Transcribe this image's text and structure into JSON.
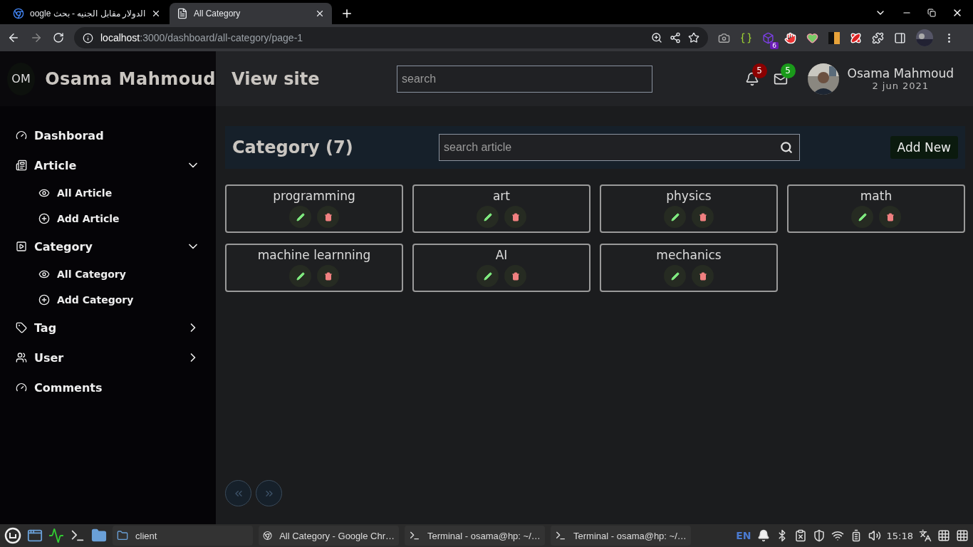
{
  "browser": {
    "tabs": [
      {
        "title": "الدولار مقابل الجنيه - بحث oogle",
        "selected": false
      },
      {
        "title": "All Category",
        "selected": true
      }
    ],
    "url_host": "localhost",
    "url_path": ":3000/dashboard/all-category/page-1",
    "extension_badge": "6"
  },
  "sidebar": {
    "initials": "OM",
    "brand": "Osama Mahmoud",
    "items": [
      {
        "label": "Dashborad",
        "kind": "link"
      },
      {
        "label": "Article",
        "kind": "group",
        "expanded": true,
        "children": [
          {
            "label": "All Article",
            "kind": "view"
          },
          {
            "label": "Add Article",
            "kind": "add"
          }
        ]
      },
      {
        "label": "Category",
        "kind": "group",
        "expanded": true,
        "children": [
          {
            "label": "All Category",
            "kind": "view"
          },
          {
            "label": "Add Category",
            "kind": "add"
          }
        ]
      },
      {
        "label": "Tag",
        "kind": "group",
        "expanded": false
      },
      {
        "label": "User",
        "kind": "group",
        "expanded": false
      },
      {
        "label": "Comments",
        "kind": "link"
      }
    ]
  },
  "header": {
    "title": "View site",
    "search": {
      "placeholder": "search"
    },
    "notifications": "5",
    "messages": "5",
    "user": {
      "name": "Osama Mahmoud",
      "date": "2 jun 2021"
    }
  },
  "content": {
    "title": "Category (7)",
    "search": {
      "placeholder": "search article"
    },
    "add_button": "Add New",
    "categories": [
      {
        "name": "programming"
      },
      {
        "name": "art"
      },
      {
        "name": "physics"
      },
      {
        "name": "math"
      },
      {
        "name": "machine learnning"
      },
      {
        "name": "AI"
      },
      {
        "name": "mechanics"
      }
    ]
  },
  "taskbar": {
    "windows": [
      {
        "label": "client",
        "kind": "folder"
      },
      {
        "label": "All Category - Google Chr…",
        "kind": "browser"
      },
      {
        "label": "Terminal - osama@hp: ~/…",
        "kind": "terminal"
      },
      {
        "label": "Terminal - osama@hp: ~/…",
        "kind": "terminal"
      }
    ],
    "language": "EN",
    "clock": "15:18"
  }
}
